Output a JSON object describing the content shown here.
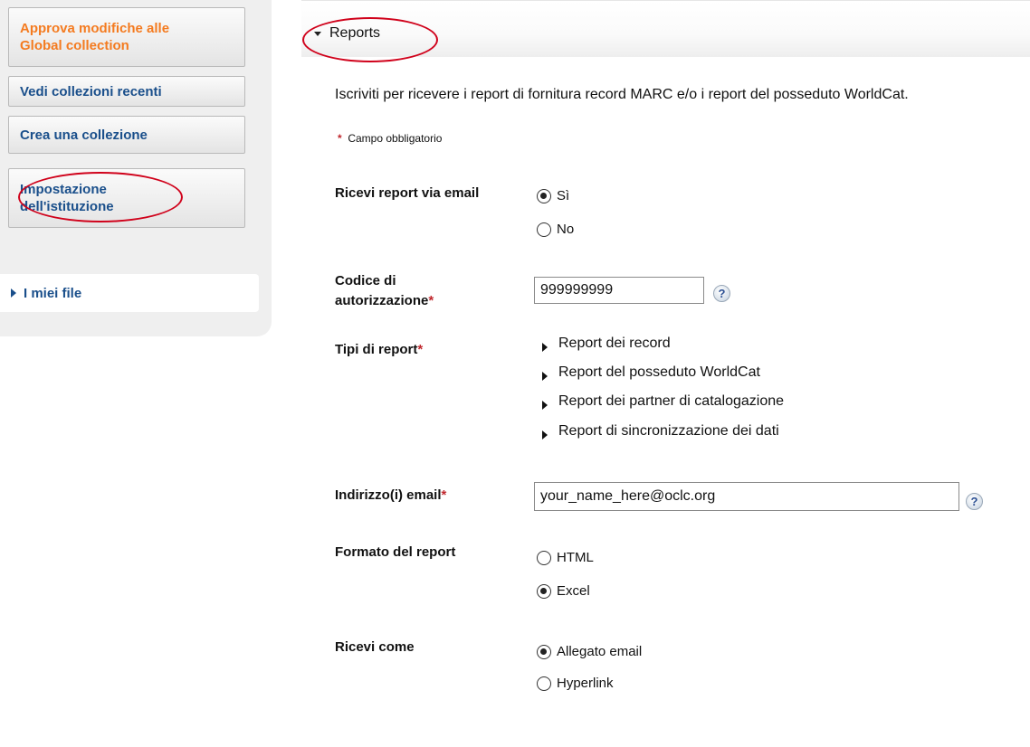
{
  "sidebar": {
    "approve_label_1": "Approva modifiche alle",
    "approve_label_2": "Global collection",
    "recent_label": "Vedi collezioni recenti",
    "create_label": "Crea una collezione",
    "institution_label_1": "Impostazione",
    "institution_label_2": "dell'istituzione",
    "my_files_label": "I miei file"
  },
  "header": {
    "title": "Reports"
  },
  "main": {
    "intro": "Iscriviti per ricevere i report di fornitura record MARC e/o i report del posseduto WorldCat.",
    "required_mark": "*",
    "required_note": "Campo obbligatorio",
    "email_reports": {
      "label": "Ricevi report via email",
      "options": [
        {
          "label": "Sì",
          "selected": true
        },
        {
          "label": "No",
          "selected": false
        }
      ]
    },
    "auth_code": {
      "label_1": "Codice di",
      "label_2": "autorizzazione",
      "value": "999999999",
      "help": "?"
    },
    "report_types": {
      "label": "Tipi di report",
      "items": [
        "Report dei record",
        "Report del posseduto WorldCat",
        "Report dei partner di catalogazione",
        "Report di sincronizzazione dei dati"
      ]
    },
    "email": {
      "label": "Indirizzo(i) email",
      "value": "your_name_here@oclc.org",
      "help": "?"
    },
    "format": {
      "label": "Formato del report",
      "options": [
        {
          "label": "HTML",
          "selected": false
        },
        {
          "label": "Excel",
          "selected": true
        }
      ]
    },
    "receive_as": {
      "label": "Ricevi come",
      "options": [
        {
          "label": "Allegato email",
          "selected": true
        },
        {
          "label": "Hyperlink",
          "selected": false
        }
      ]
    }
  },
  "colors": {
    "orange_link": "#f47b20",
    "blue_link": "#1a4f8b",
    "annotation_red": "#d0021b",
    "required_red": "#c0272d"
  }
}
